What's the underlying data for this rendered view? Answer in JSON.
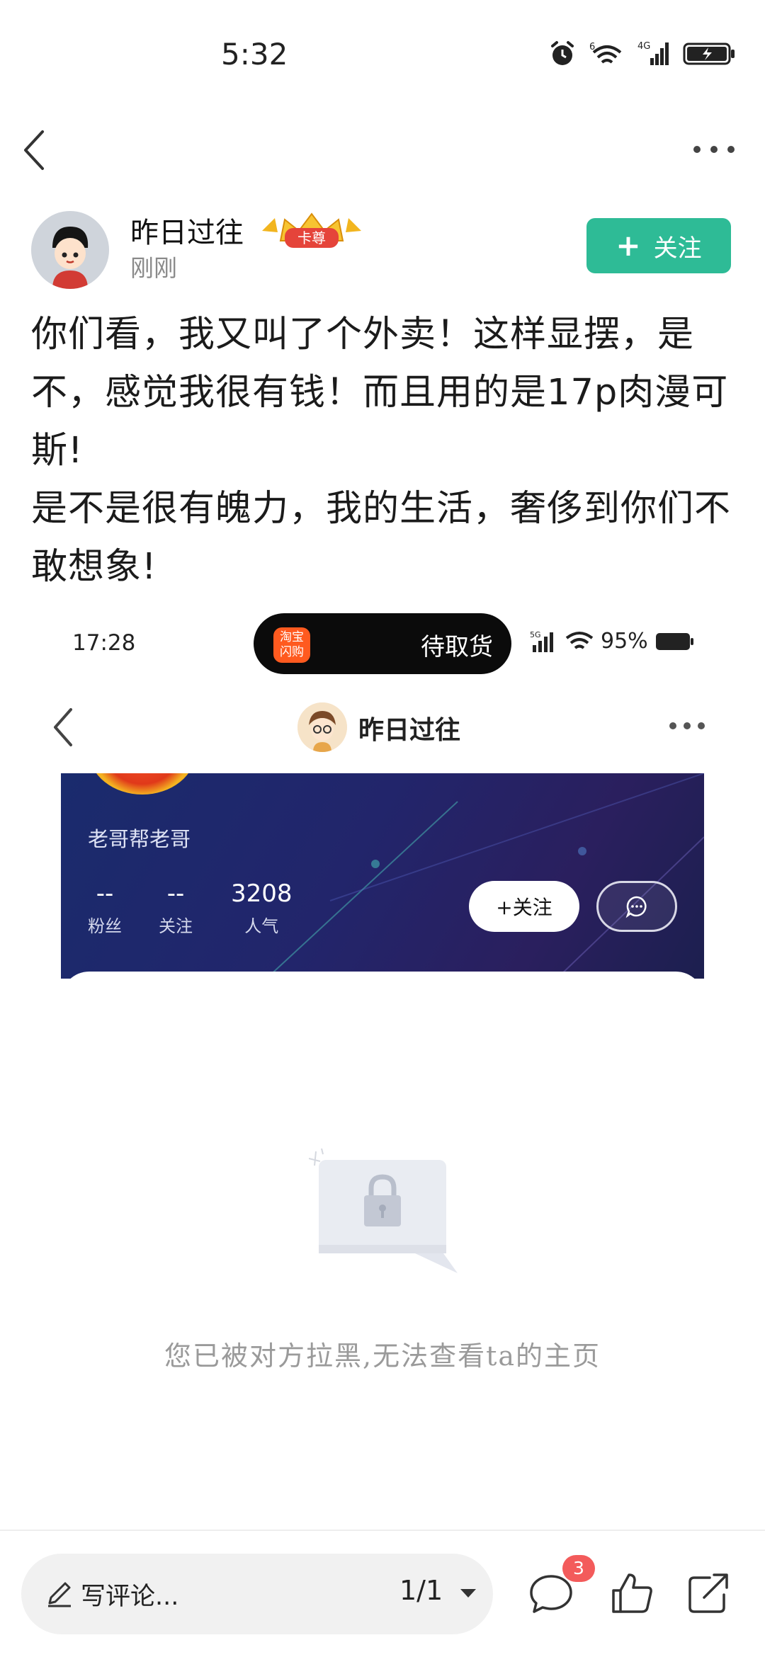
{
  "status_bar": {
    "time": "5:32",
    "icons": [
      "alarm-icon",
      "wifi-6-icon",
      "signal-4g-icon",
      "battery-charging-icon"
    ]
  },
  "nav": {
    "back_icon": "chevron-left-icon",
    "more_icon": "more-horizontal-icon"
  },
  "author": {
    "name": "昨日过往",
    "badge": "卡尊",
    "time": "刚刚",
    "follow_label": "关注",
    "follow_color": "#2ebb96"
  },
  "post": {
    "paragraphs": [
      "你们看，我又叫了个外卖！这样显摆，是不，感觉我很有钱！而且用的是17p肉漫可斯!",
      "是不是很有魄力，我的生活，奢侈到你们不敢想象!"
    ]
  },
  "embedded_screenshot": {
    "status_time": "17:28",
    "pill_app_label": "淘宝\n闪购",
    "pill_text": "待取货",
    "network": "5G",
    "battery": "95%",
    "profile_name": "昨日过往",
    "bio": "老哥帮老哥",
    "stats": [
      {
        "value": "--",
        "label": "粉丝"
      },
      {
        "value": "--",
        "label": "关注"
      },
      {
        "value": "3208",
        "label": "人气"
      }
    ],
    "follow_label": "+关注",
    "blocked_message": "您已被对方拉黑,无法查看ta的主页"
  },
  "bottom_bar": {
    "comment_placeholder": "写评论...",
    "page_indicator": "1/1",
    "comment_count": "3",
    "icons": [
      "comment-icon",
      "like-icon",
      "share-icon"
    ]
  }
}
